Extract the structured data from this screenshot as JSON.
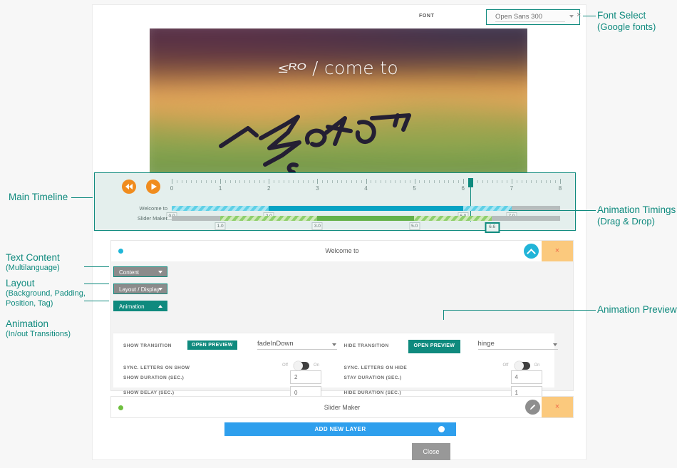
{
  "window": {
    "close_icon": "×"
  },
  "fontbar": {
    "label": "FONT",
    "selected": "Open Sans 300"
  },
  "preview": {
    "headline_partial": "≤ᴿᴼ",
    "headline_rest": "/ come to",
    "signature_alt": "handwritten-signature"
  },
  "timeline": {
    "rewind_label": "rewind",
    "play_label": "play",
    "ruler_ticks": [
      "0",
      "1",
      "2",
      "3",
      "4",
      "5",
      "6",
      "7",
      "8"
    ],
    "playhead": 6.15,
    "tracks": [
      {
        "name": "Welcome to",
        "chips": [
          {
            "value": "0.0",
            "at": 0.0,
            "active": false
          },
          {
            "value": "2.0",
            "at": 2.0,
            "active": false
          },
          {
            "value": "6.0",
            "at": 6.0,
            "active": false
          },
          {
            "value": "7.0",
            "at": 7.0,
            "active": false
          }
        ]
      },
      {
        "name": "Slider Maker",
        "chips": [
          {
            "value": "1.0",
            "at": 1.0,
            "active": false
          },
          {
            "value": "3.0",
            "at": 3.0,
            "active": false
          },
          {
            "value": "5.0",
            "at": 5.0,
            "active": false
          },
          {
            "value": "6.6",
            "at": 6.6,
            "active": true
          }
        ]
      }
    ]
  },
  "layer1": {
    "title": "Welcome to",
    "collapse_label": "collapse",
    "close_label": "×",
    "tabs": [
      {
        "label": "Content",
        "active": false
      },
      {
        "label": "Layout / Display",
        "active": false
      },
      {
        "label": "Animation",
        "active": true
      }
    ],
    "settings": {
      "show_transition_label": "Show Transition",
      "show_transition_preview": "OPEN PREVIEW",
      "show_transition_value": "fadeInDown",
      "sync_show_label": "Sync. Letters on Show",
      "sync_show_off": "Off",
      "sync_show_on": "On",
      "show_duration_label": "Show Duration (sec.)",
      "show_duration_value": "2",
      "show_delay_label": "Show Delay (sec.)",
      "show_delay_value": "0",
      "hide_transition_label": "Hide Transition",
      "hide_transition_preview": "OPEN PREVIEW",
      "hide_transition_value": "hinge",
      "sync_hide_label": "Sync. Letters on Hide",
      "sync_hide_off": "Off",
      "sync_hide_on": "On",
      "stay_duration_label": "Stay Duration (sec.)",
      "stay_duration_value": "4",
      "hide_duration_label": "Hide Duration (sec.)",
      "hide_duration_value": "1"
    }
  },
  "layer2": {
    "title": "Slider Maker",
    "edit_label": "edit",
    "close_label": "×"
  },
  "actions": {
    "add_new_layer": "ADD NEW LAYER",
    "close": "Close"
  },
  "annotations": {
    "main_timeline": "Main Timeline",
    "text_content": "Text Content",
    "text_content_sub": "(Multilanguage)",
    "layout": "Layout",
    "layout_sub1": "(Background, Padding,",
    "layout_sub2": "Position, Tag)",
    "animation": "Animation",
    "animation_sub": "(In/out Transitions)",
    "font_select": "Font Select",
    "font_select_sub": "(Google fonts)",
    "animation_timings": "Animation Timings",
    "animation_timings_sub": "(Drag & Drop)",
    "animation_preview": "Animation Preview"
  },
  "colors": {
    "teal": "#0f8a7e",
    "orange": "#f08c1e",
    "blue": "#2e9fed",
    "cyan": "#06a3c4",
    "green": "#64b14a",
    "amber": "#fbc97d"
  }
}
